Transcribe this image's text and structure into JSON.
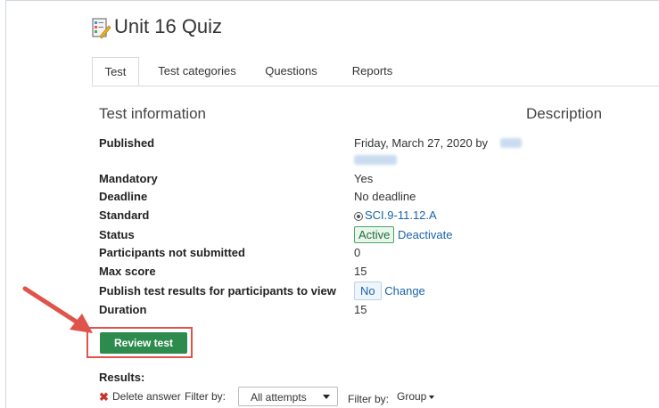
{
  "page": {
    "title": "Unit 16 Quiz",
    "title_icon": "quiz-document-icon"
  },
  "tabs": [
    {
      "label": "Test",
      "active": true
    },
    {
      "label": "Test categories",
      "active": false
    },
    {
      "label": "Questions",
      "active": false
    },
    {
      "label": "Reports",
      "active": false
    }
  ],
  "info": {
    "section_title": "Test information",
    "description_title": "Description",
    "published_label": "Published",
    "published_value": "Friday, March 27, 2020 by",
    "mandatory_label": "Mandatory",
    "mandatory_value": "Yes",
    "deadline_label": "Deadline",
    "deadline_value": "No deadline",
    "standard_label": "Standard",
    "standard_value": "SCI.9-11.12.A",
    "status_label": "Status",
    "status_badge": "Active",
    "status_action": "Deactivate",
    "not_submitted_label": "Participants not submitted",
    "not_submitted_value": "0",
    "max_score_label": "Max score",
    "max_score_value": "15",
    "publish_label": "Publish test results for participants to view",
    "publish_value": "No",
    "publish_action": "Change",
    "duration_label": "Duration",
    "duration_value": "15"
  },
  "actions": {
    "review_label": "Review test"
  },
  "results": {
    "label": "Results:",
    "delete_label": "Delete answer",
    "filter_by_1": "Filter by:",
    "attempts_selected": "All attempts",
    "filter_by_2": "Filter by:",
    "group_label": "Group"
  },
  "colors": {
    "accent_green": "#2e8b4e",
    "link_blue": "#1a64a8",
    "highlight_red": "#e0534a"
  }
}
